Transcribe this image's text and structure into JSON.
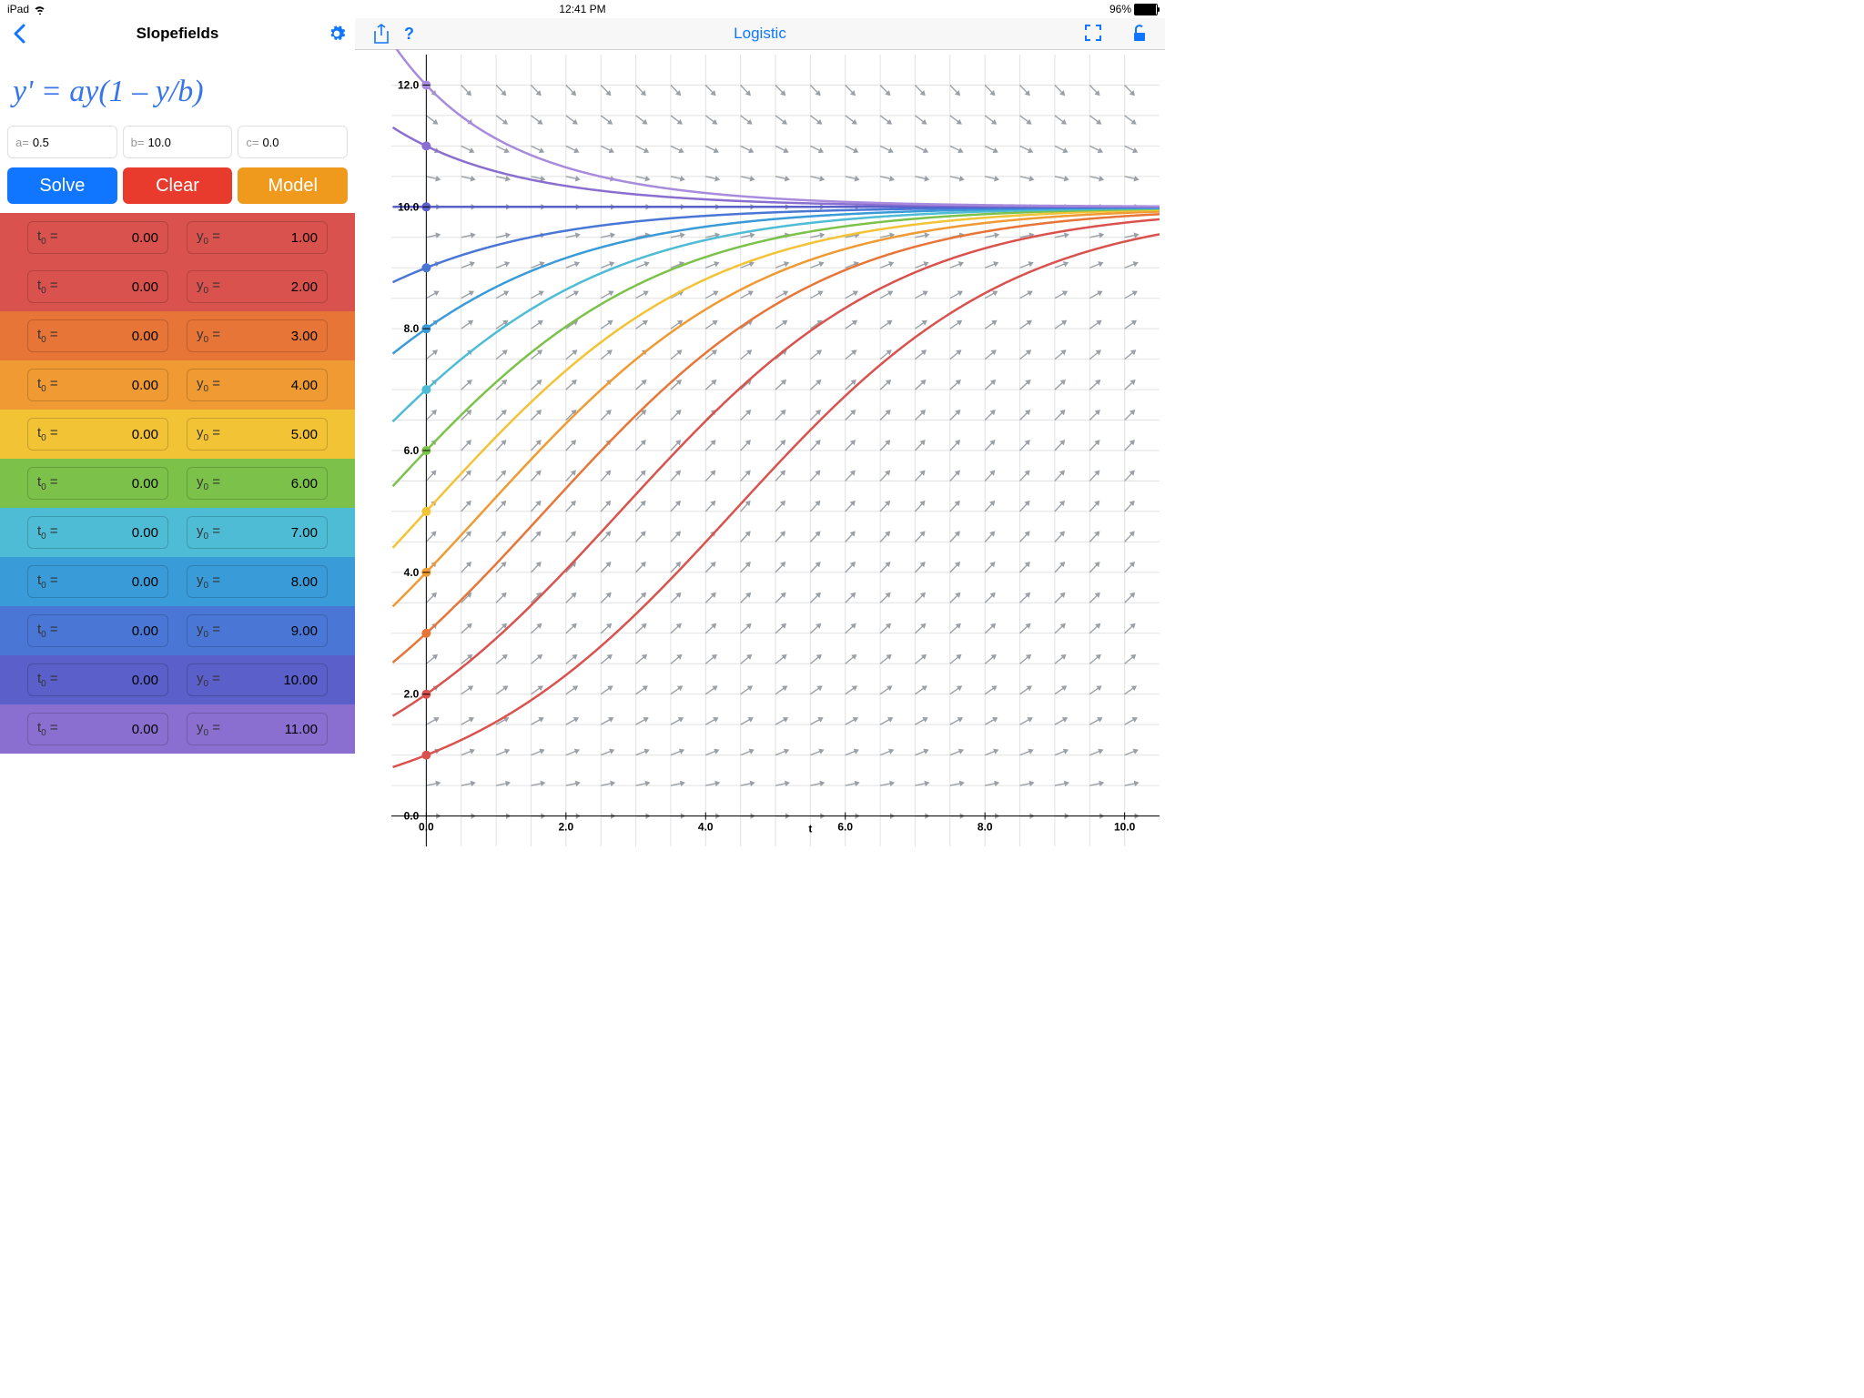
{
  "status": {
    "device": "iPad",
    "time": "12:41 PM",
    "battery": "96%"
  },
  "nav": {
    "left_title": "Slopefields",
    "right_title": "Logistic"
  },
  "equation": "y'  =   ay(1 – y/b)",
  "params": {
    "a_label": "a=",
    "a": "0.5",
    "b_label": "b=",
    "b": "10.0",
    "c_label": "c=",
    "c": "0.0"
  },
  "buttons": {
    "solve": "Solve",
    "clear": "Clear",
    "model": "Model"
  },
  "rows": [
    {
      "t0": "0.00",
      "y0": "1.00",
      "color": "#d9524e"
    },
    {
      "t0": "0.00",
      "y0": "2.00",
      "color": "#d9524e"
    },
    {
      "t0": "0.00",
      "y0": "3.00",
      "color": "#e87538"
    },
    {
      "t0": "0.00",
      "y0": "4.00",
      "color": "#f09a33"
    },
    {
      "t0": "0.00",
      "y0": "5.00",
      "color": "#f3c336"
    },
    {
      "t0": "0.00",
      "y0": "6.00",
      "color": "#7cc24a"
    },
    {
      "t0": "0.00",
      "y0": "7.00",
      "color": "#4ebcd5"
    },
    {
      "t0": "0.00",
      "y0": "8.00",
      "color": "#3a9bd9"
    },
    {
      "t0": "0.00",
      "y0": "9.00",
      "color": "#4a77d6"
    },
    {
      "t0": "0.00",
      "y0": "10.00",
      "color": "#5a5fc9"
    },
    {
      "t0": "0.00",
      "y0": "11.00",
      "color": "#8a6fd0"
    }
  ],
  "row_labels": {
    "t0": "t",
    "t0sub": "0",
    "eq": " =",
    "y0": "y",
    "y0sub": "0"
  },
  "chart_data": {
    "type": "line",
    "title": "Logistic",
    "xlabel": "t",
    "ylabel": "",
    "xlim": [
      -0.5,
      10.5
    ],
    "ylim": [
      -0.5,
      12.5
    ],
    "xticks": [
      0,
      2,
      4,
      6,
      8,
      10
    ],
    "yticks": [
      0,
      2,
      4,
      6,
      8,
      10,
      12
    ],
    "equation": "y' = 0.5 * y * (1 - y/10)",
    "params": {
      "a": 0.5,
      "b": 10.0,
      "c": 0.0
    },
    "series": [
      {
        "name": "y0=1",
        "y0": 1,
        "color": "#d9524e"
      },
      {
        "name": "y0=2",
        "y0": 2,
        "color": "#d9524e"
      },
      {
        "name": "y0=3",
        "y0": 3,
        "color": "#e87538"
      },
      {
        "name": "y0=4",
        "y0": 4,
        "color": "#f09a33"
      },
      {
        "name": "y0=5",
        "y0": 5,
        "color": "#f3c336"
      },
      {
        "name": "y0=6",
        "y0": 6,
        "color": "#7cc24a"
      },
      {
        "name": "y0=7",
        "y0": 7,
        "color": "#4ebcd5"
      },
      {
        "name": "y0=8",
        "y0": 8,
        "color": "#3a9bd9"
      },
      {
        "name": "y0=9",
        "y0": 9,
        "color": "#4a77d6"
      },
      {
        "name": "y0=10",
        "y0": 10,
        "color": "#5a5fc9"
      },
      {
        "name": "y0=11",
        "y0": 11,
        "color": "#8a6fd0"
      },
      {
        "name": "y0=12",
        "y0": 12,
        "color": "#a88bdc"
      }
    ],
    "slope_formula": "dy/dt = 0.5*y*(1-y/10)"
  }
}
